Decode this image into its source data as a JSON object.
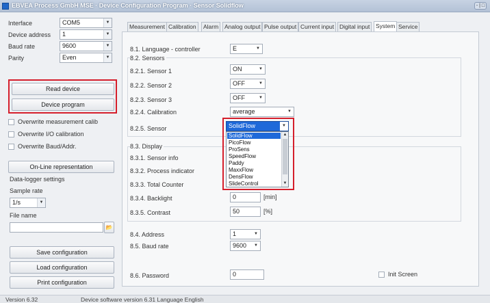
{
  "window": {
    "title": "EBVEA Process GmbH MSE · Device Configuration Program · Sensor Solidflow",
    "controls": "- | □"
  },
  "settings": {
    "interface": {
      "label": "Interface",
      "value": "COM5"
    },
    "device_address": {
      "label": "Device address",
      "value": "1"
    },
    "baud_rate": {
      "label": "Baud rate",
      "value": "9600"
    },
    "parity": {
      "label": "Parity",
      "value": "Even"
    }
  },
  "actions": {
    "read_device": "Read device",
    "device_program": "Device program"
  },
  "options": {
    "overwrite_calib": "Overwrite measurement calib",
    "overwrite_io": "Overwrite I/O calibration",
    "overwrite_baud": "Overwrite Baud/Addr."
  },
  "online_button": "On-Line representation",
  "datalogger": {
    "title": "Data-logger settings",
    "sample_rate_label": "Sample rate",
    "sample_rate_value": "1/s",
    "file_name_label": "File name",
    "file_name_value": "",
    "browse_glyph": "📂"
  },
  "config_buttons": {
    "save": "Save configuration",
    "load": "Load configuration",
    "print": "Print configuration"
  },
  "tabs": [
    "Measurement",
    "Calibration",
    "Alarm",
    "Analog output",
    "Pulse output",
    "Current input",
    "Digital input",
    "System",
    "Service"
  ],
  "system": {
    "language": {
      "label": "8.1. Language - controller",
      "value": "E"
    },
    "sensors_title": "8.2. Sensors",
    "sensor1": {
      "label": "8.2.1. Sensor 1",
      "value": "ON"
    },
    "sensor2": {
      "label": "8.2.2. Sensor 2",
      "value": "OFF"
    },
    "sensor3": {
      "label": "8.2.3. Sensor 3",
      "value": "OFF"
    },
    "calibration": {
      "label": "8.2.4. Calibration",
      "value": "average"
    },
    "sensor": {
      "label": "8.2.5. Sensor",
      "value": "SolidFlow"
    },
    "display_title": "8.3. Display",
    "sensor_info": {
      "label": "8.3.1. Sensor info"
    },
    "process_indicator": {
      "label": "8.3.2. Process indicator"
    },
    "total_counter": {
      "label": "8.3.3. Total Counter"
    },
    "backlight": {
      "label": "8.3.4. Backlight",
      "value": "0",
      "unit": "[min]"
    },
    "contrast": {
      "label": "8.3.5. Contrast",
      "value": "50",
      "unit": "[%]"
    },
    "address": {
      "label": "8.4. Address",
      "value": "1"
    },
    "baud_rate": {
      "label": "8.5. Baud rate",
      "value": "9600"
    },
    "password": {
      "label": "8.6. Password",
      "value": "0"
    },
    "init_screen": "Init Screen"
  },
  "sensor_dropdown": [
    "SolidFlow",
    "PicoFlow",
    "ProSens",
    "SpeedFlow",
    "Paddy",
    "MaxxFlow",
    "DensFlow",
    "SlideControl"
  ],
  "status": {
    "version": "Version 6.32",
    "device_info": "Device software version  6.31   Language  English"
  },
  "colors": {
    "highlight": "#d51e2b",
    "selection": "#1f69d9"
  }
}
